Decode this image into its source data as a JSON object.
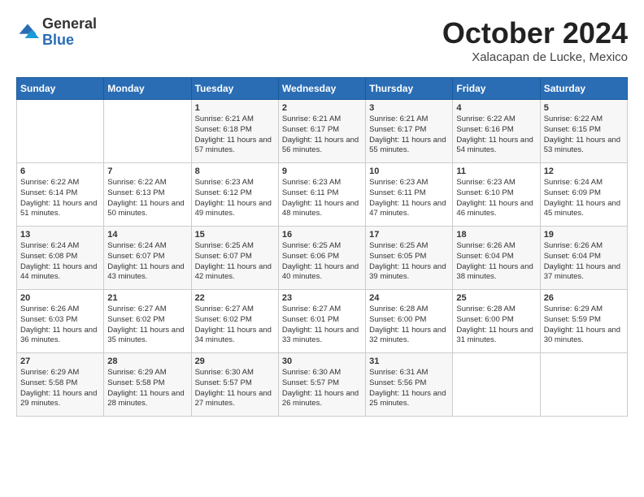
{
  "logo": {
    "general": "General",
    "blue": "Blue"
  },
  "header": {
    "month": "October 2024",
    "location": "Xalacapan de Lucke, Mexico"
  },
  "days_of_week": [
    "Sunday",
    "Monday",
    "Tuesday",
    "Wednesday",
    "Thursday",
    "Friday",
    "Saturday"
  ],
  "weeks": [
    [
      {
        "day": "",
        "sunrise": "",
        "sunset": "",
        "daylight": ""
      },
      {
        "day": "",
        "sunrise": "",
        "sunset": "",
        "daylight": ""
      },
      {
        "day": "1",
        "sunrise": "Sunrise: 6:21 AM",
        "sunset": "Sunset: 6:18 PM",
        "daylight": "Daylight: 11 hours and 57 minutes."
      },
      {
        "day": "2",
        "sunrise": "Sunrise: 6:21 AM",
        "sunset": "Sunset: 6:17 PM",
        "daylight": "Daylight: 11 hours and 56 minutes."
      },
      {
        "day": "3",
        "sunrise": "Sunrise: 6:21 AM",
        "sunset": "Sunset: 6:17 PM",
        "daylight": "Daylight: 11 hours and 55 minutes."
      },
      {
        "day": "4",
        "sunrise": "Sunrise: 6:22 AM",
        "sunset": "Sunset: 6:16 PM",
        "daylight": "Daylight: 11 hours and 54 minutes."
      },
      {
        "day": "5",
        "sunrise": "Sunrise: 6:22 AM",
        "sunset": "Sunset: 6:15 PM",
        "daylight": "Daylight: 11 hours and 53 minutes."
      }
    ],
    [
      {
        "day": "6",
        "sunrise": "Sunrise: 6:22 AM",
        "sunset": "Sunset: 6:14 PM",
        "daylight": "Daylight: 11 hours and 51 minutes."
      },
      {
        "day": "7",
        "sunrise": "Sunrise: 6:22 AM",
        "sunset": "Sunset: 6:13 PM",
        "daylight": "Daylight: 11 hours and 50 minutes."
      },
      {
        "day": "8",
        "sunrise": "Sunrise: 6:23 AM",
        "sunset": "Sunset: 6:12 PM",
        "daylight": "Daylight: 11 hours and 49 minutes."
      },
      {
        "day": "9",
        "sunrise": "Sunrise: 6:23 AM",
        "sunset": "Sunset: 6:11 PM",
        "daylight": "Daylight: 11 hours and 48 minutes."
      },
      {
        "day": "10",
        "sunrise": "Sunrise: 6:23 AM",
        "sunset": "Sunset: 6:11 PM",
        "daylight": "Daylight: 11 hours and 47 minutes."
      },
      {
        "day": "11",
        "sunrise": "Sunrise: 6:23 AM",
        "sunset": "Sunset: 6:10 PM",
        "daylight": "Daylight: 11 hours and 46 minutes."
      },
      {
        "day": "12",
        "sunrise": "Sunrise: 6:24 AM",
        "sunset": "Sunset: 6:09 PM",
        "daylight": "Daylight: 11 hours and 45 minutes."
      }
    ],
    [
      {
        "day": "13",
        "sunrise": "Sunrise: 6:24 AM",
        "sunset": "Sunset: 6:08 PM",
        "daylight": "Daylight: 11 hours and 44 minutes."
      },
      {
        "day": "14",
        "sunrise": "Sunrise: 6:24 AM",
        "sunset": "Sunset: 6:07 PM",
        "daylight": "Daylight: 11 hours and 43 minutes."
      },
      {
        "day": "15",
        "sunrise": "Sunrise: 6:25 AM",
        "sunset": "Sunset: 6:07 PM",
        "daylight": "Daylight: 11 hours and 42 minutes."
      },
      {
        "day": "16",
        "sunrise": "Sunrise: 6:25 AM",
        "sunset": "Sunset: 6:06 PM",
        "daylight": "Daylight: 11 hours and 40 minutes."
      },
      {
        "day": "17",
        "sunrise": "Sunrise: 6:25 AM",
        "sunset": "Sunset: 6:05 PM",
        "daylight": "Daylight: 11 hours and 39 minutes."
      },
      {
        "day": "18",
        "sunrise": "Sunrise: 6:26 AM",
        "sunset": "Sunset: 6:04 PM",
        "daylight": "Daylight: 11 hours and 38 minutes."
      },
      {
        "day": "19",
        "sunrise": "Sunrise: 6:26 AM",
        "sunset": "Sunset: 6:04 PM",
        "daylight": "Daylight: 11 hours and 37 minutes."
      }
    ],
    [
      {
        "day": "20",
        "sunrise": "Sunrise: 6:26 AM",
        "sunset": "Sunset: 6:03 PM",
        "daylight": "Daylight: 11 hours and 36 minutes."
      },
      {
        "day": "21",
        "sunrise": "Sunrise: 6:27 AM",
        "sunset": "Sunset: 6:02 PM",
        "daylight": "Daylight: 11 hours and 35 minutes."
      },
      {
        "day": "22",
        "sunrise": "Sunrise: 6:27 AM",
        "sunset": "Sunset: 6:02 PM",
        "daylight": "Daylight: 11 hours and 34 minutes."
      },
      {
        "day": "23",
        "sunrise": "Sunrise: 6:27 AM",
        "sunset": "Sunset: 6:01 PM",
        "daylight": "Daylight: 11 hours and 33 minutes."
      },
      {
        "day": "24",
        "sunrise": "Sunrise: 6:28 AM",
        "sunset": "Sunset: 6:00 PM",
        "daylight": "Daylight: 11 hours and 32 minutes."
      },
      {
        "day": "25",
        "sunrise": "Sunrise: 6:28 AM",
        "sunset": "Sunset: 6:00 PM",
        "daylight": "Daylight: 11 hours and 31 minutes."
      },
      {
        "day": "26",
        "sunrise": "Sunrise: 6:29 AM",
        "sunset": "Sunset: 5:59 PM",
        "daylight": "Daylight: 11 hours and 30 minutes."
      }
    ],
    [
      {
        "day": "27",
        "sunrise": "Sunrise: 6:29 AM",
        "sunset": "Sunset: 5:58 PM",
        "daylight": "Daylight: 11 hours and 29 minutes."
      },
      {
        "day": "28",
        "sunrise": "Sunrise: 6:29 AM",
        "sunset": "Sunset: 5:58 PM",
        "daylight": "Daylight: 11 hours and 28 minutes."
      },
      {
        "day": "29",
        "sunrise": "Sunrise: 6:30 AM",
        "sunset": "Sunset: 5:57 PM",
        "daylight": "Daylight: 11 hours and 27 minutes."
      },
      {
        "day": "30",
        "sunrise": "Sunrise: 6:30 AM",
        "sunset": "Sunset: 5:57 PM",
        "daylight": "Daylight: 11 hours and 26 minutes."
      },
      {
        "day": "31",
        "sunrise": "Sunrise: 6:31 AM",
        "sunset": "Sunset: 5:56 PM",
        "daylight": "Daylight: 11 hours and 25 minutes."
      },
      {
        "day": "",
        "sunrise": "",
        "sunset": "",
        "daylight": ""
      },
      {
        "day": "",
        "sunrise": "",
        "sunset": "",
        "daylight": ""
      }
    ]
  ]
}
